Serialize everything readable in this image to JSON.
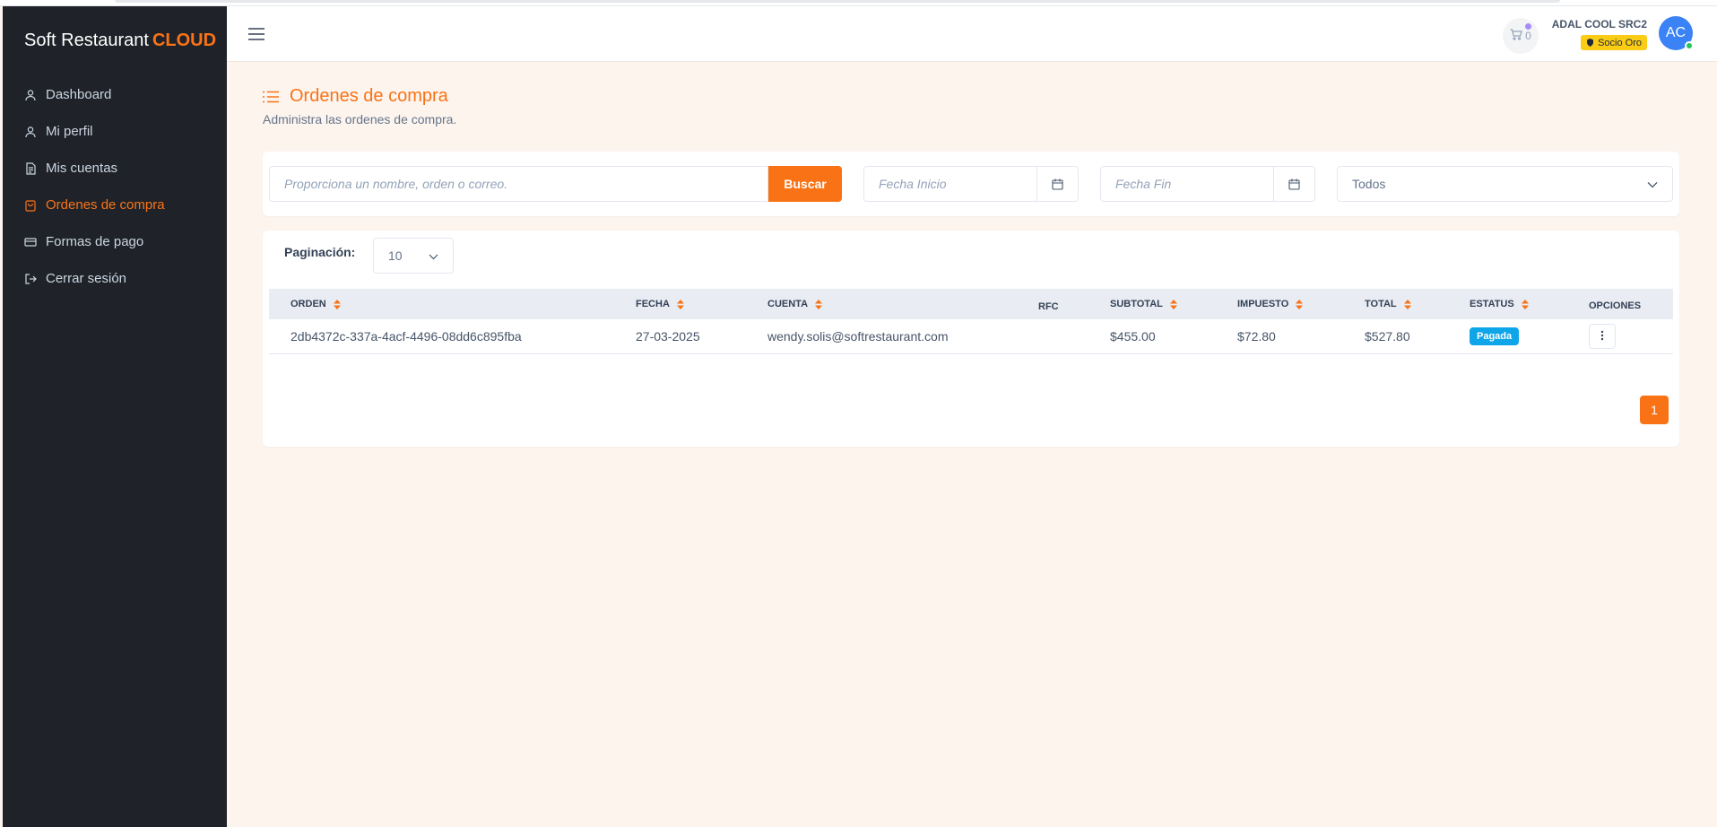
{
  "brand": {
    "name": "Soft Restaurant",
    "accent": "CLOUD"
  },
  "sidebar": {
    "items": [
      {
        "label": "Dashboard",
        "icon": "user-icon"
      },
      {
        "label": "Mi perfil",
        "icon": "user-icon"
      },
      {
        "label": "Mis cuentas",
        "icon": "document-icon"
      },
      {
        "label": "Ordenes de compra",
        "icon": "bag-icon",
        "active": true
      },
      {
        "label": "Formas de pago",
        "icon": "credit-card-icon"
      },
      {
        "label": "Cerrar sesión",
        "icon": "logout-icon"
      }
    ]
  },
  "header": {
    "cart_count": "0",
    "user_name": "ADAL COOL SRC2",
    "membership": "Socio Oro",
    "avatar_initials": "AC"
  },
  "page": {
    "title": "Ordenes de compra",
    "subtitle": "Administra las ordenes de compra."
  },
  "filters": {
    "search_placeholder": "Proporciona un nombre, orden o correo.",
    "search_button": "Buscar",
    "date_start_placeholder": "Fecha Inicio",
    "date_end_placeholder": "Fecha Fin",
    "status_selected": "Todos"
  },
  "pagination": {
    "label": "Paginación:",
    "per_page": "10",
    "current_page": "1"
  },
  "table": {
    "columns": [
      "ORDEN",
      "FECHA",
      "CUENTA",
      "RFC",
      "SUBTOTAL",
      "IMPUESTO",
      "TOTAL",
      "ESTATUS",
      "OPCIONES"
    ],
    "rows": [
      {
        "orden": "2db4372c-337a-4acf-4496-08dd6c895fba",
        "fecha": "27-03-2025",
        "cuenta": "wendy.solis@softrestaurant.com",
        "rfc": "",
        "subtotal": "$455.00",
        "impuesto": "$72.80",
        "total": "$527.80",
        "estatus": "Pagada"
      }
    ]
  },
  "colors": {
    "accent": "#f97316",
    "sidebar_bg": "#1f2329",
    "status_paid": "#0ea5e9",
    "gold_badge": "#facc15",
    "avatar": "#3b82f6"
  }
}
